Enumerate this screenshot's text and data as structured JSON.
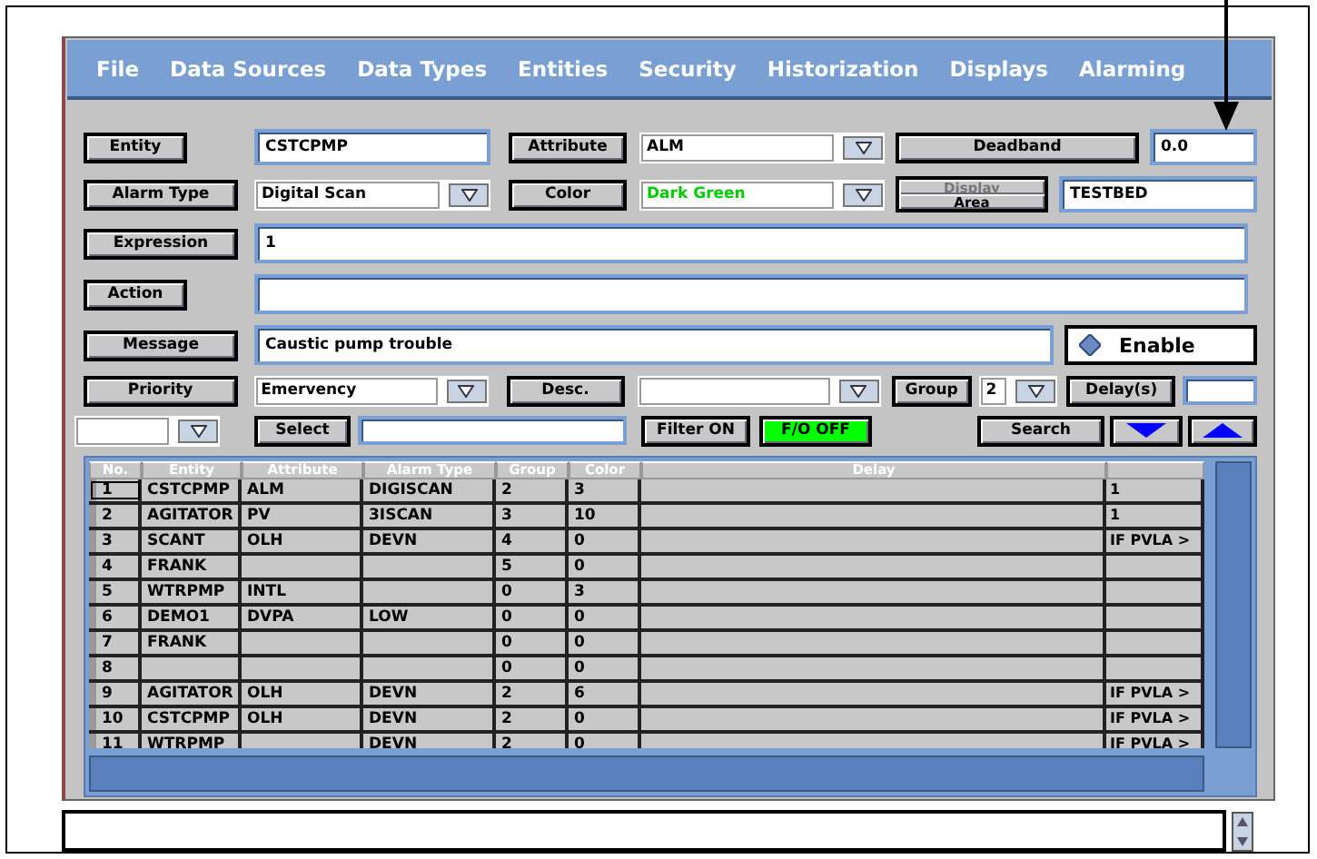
{
  "menu": [
    "File",
    "Data Sources",
    "Data Types",
    "Entities",
    "Security",
    "Historization",
    "Displays",
    "Alarming"
  ],
  "entity": {
    "label": "Entity",
    "value": "CSTCPMP"
  },
  "attribute": {
    "label": "Attribute",
    "value": "ALM"
  },
  "deadband": {
    "label": "Deadband",
    "value": "0.0"
  },
  "alarm_type": {
    "label": "Alarm Type",
    "value": "Digital Scan"
  },
  "color": {
    "label": "Color",
    "value": "Dark Green"
  },
  "display_area": {
    "buttons": [
      {
        "label": "Display",
        "disabled": true
      },
      {
        "label": "Area",
        "disabled": false
      }
    ],
    "value": "TESTBED"
  },
  "expression": {
    "label": "Expression",
    "value": "1"
  },
  "action": {
    "label": "Action"
  },
  "message": {
    "label": "Message",
    "value": "Caustic pump trouble"
  },
  "enable": {
    "label": "Enable"
  },
  "priority": {
    "label": "Priority",
    "value": "Emervency"
  },
  "desc": {
    "label": "Desc."
  },
  "group": {
    "label": "Group",
    "value": "2"
  },
  "delay": {
    "label": "Delay(s)"
  },
  "select": {
    "label": "Select"
  },
  "filter": {
    "label": "Filter ON"
  },
  "fo": {
    "label": "F/O OFF",
    "on": true
  },
  "search": {
    "label": "Search"
  },
  "table": {
    "columns": [
      "No.",
      "Entity",
      "Attribute",
      "Alarm Type",
      "Group",
      "Color",
      "Delay",
      ""
    ],
    "rows": [
      {
        "cells": [
          "1",
          "CSTCPMP",
          "ALM",
          "DIGISCAN",
          "2",
          "3",
          "",
          "1"
        ],
        "selected": true
      },
      {
        "cells": [
          "2",
          "AGITATOR",
          "PV",
          "3ISCAN",
          "3",
          "10",
          "",
          "1"
        ],
        "selected": false
      },
      {
        "cells": [
          "3",
          "SCANT",
          "OLH",
          "DEVN",
          "4",
          "0",
          "",
          "IF PVLA >"
        ],
        "selected": false
      },
      {
        "cells": [
          "4",
          "FRANK",
          "",
          "",
          "5",
          "0",
          "",
          ""
        ],
        "selected": false
      },
      {
        "cells": [
          "5",
          "WTRPMP",
          "INTL",
          "",
          "0",
          "3",
          "",
          ""
        ],
        "selected": false
      },
      {
        "cells": [
          "6",
          "DEMO1",
          "DVPA",
          "LOW",
          "0",
          "0",
          "",
          ""
        ],
        "selected": false
      },
      {
        "cells": [
          "7",
          "FRANK",
          "",
          "",
          "0",
          "0",
          "",
          ""
        ],
        "selected": false
      },
      {
        "cells": [
          "8",
          "",
          "",
          "",
          "0",
          "0",
          "",
          ""
        ],
        "selected": false
      },
      {
        "cells": [
          "9",
          "AGITATOR",
          "OLH",
          "DEVN",
          "2",
          "6",
          "",
          "IF PVLA >"
        ],
        "selected": false
      },
      {
        "cells": [
          "10",
          "CSTCPMP",
          "OLH",
          "DEVN",
          "2",
          "0",
          "",
          "IF PVLA >"
        ],
        "selected": false
      },
      {
        "cells": [
          "11",
          "WTRPMP",
          "",
          "DEVN",
          "2",
          "0",
          "",
          "IF PVLA >"
        ],
        "selected": false
      }
    ]
  }
}
